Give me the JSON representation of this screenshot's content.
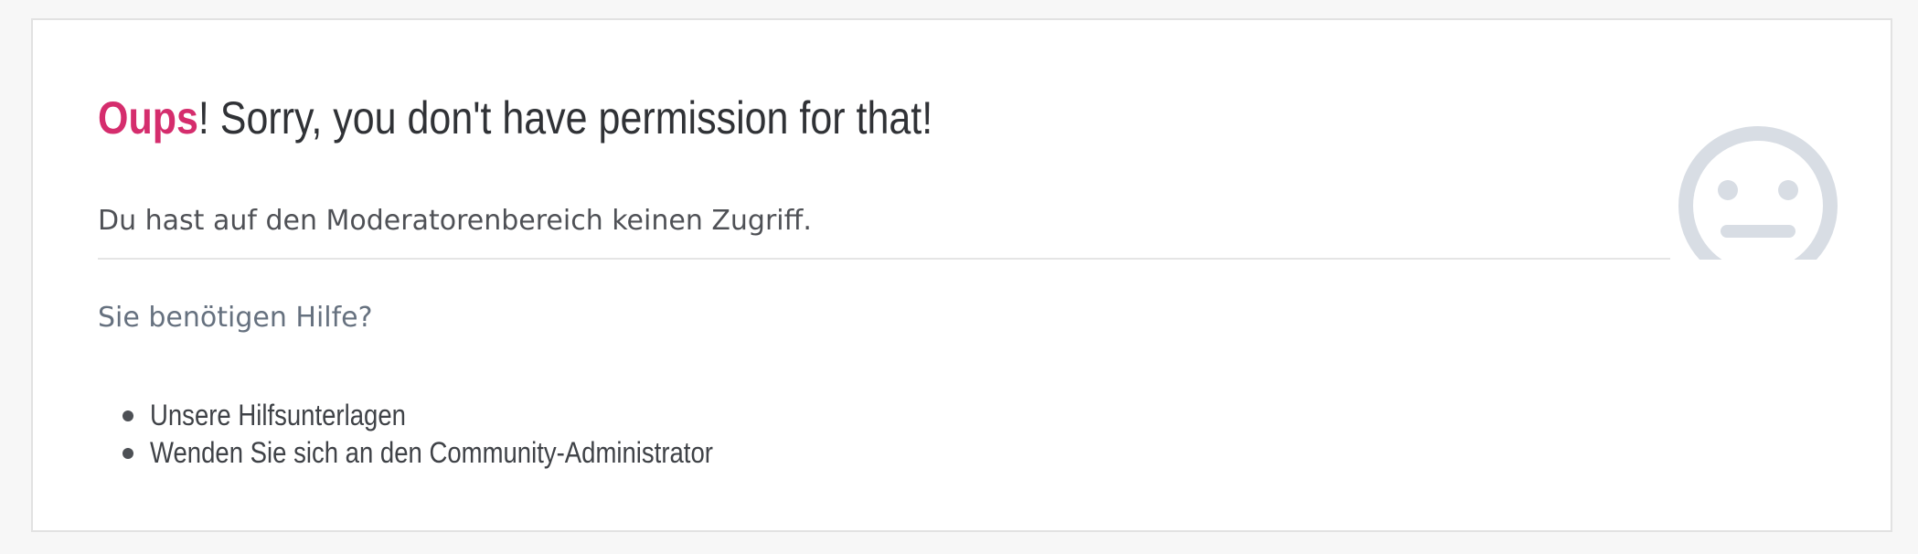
{
  "error": {
    "accent": "Oups",
    "headline_rest": "! Sorry, you don't have permission for that!",
    "message": "Du hast auf den Moderatorenbereich keinen Zugriff."
  },
  "help": {
    "heading": "Sie benötigen Hilfe?",
    "items": [
      {
        "label": "Unsere Hilfsunterlagen"
      },
      {
        "label": "Wenden Sie sich an den Community-Administrator"
      }
    ]
  },
  "icons": {
    "error_face": "neutral-face-icon"
  },
  "colors": {
    "accent": "#d52d6d",
    "headline": "#303236",
    "help_heading": "#66717f",
    "face_icon": "#d8dde4"
  }
}
